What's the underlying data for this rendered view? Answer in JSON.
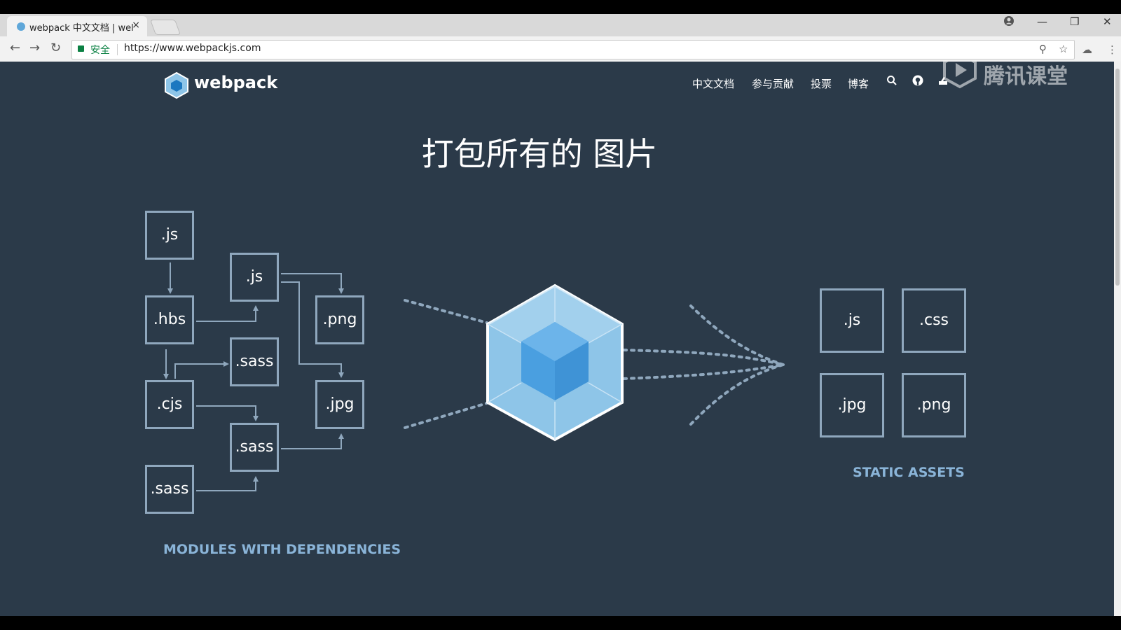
{
  "browser": {
    "tab_title": "webpack 中文文档 | wel",
    "tab_close": "×",
    "url": "https://www.webpackjs.com",
    "secure_label": "安全",
    "icons": [
      "back-icon",
      "forward-icon",
      "reload-icon",
      "lock-icon",
      "zoom-icon",
      "star-icon",
      "extension-icon",
      "menu-icon",
      "account-icon",
      "minimize-icon",
      "restore-icon",
      "close-icon"
    ]
  },
  "site": {
    "logo_text": "webpack",
    "nav": [
      "中文文档",
      "参与贡献",
      "投票",
      "博客"
    ],
    "nav_icons": [
      "search-icon",
      "github-icon",
      "language-icon"
    ]
  },
  "watermark": {
    "text": "腾讯课堂"
  },
  "hero": {
    "headline": "打包所有的 图片",
    "modules": [
      ".js",
      ".js",
      ".hbs",
      ".png",
      ".sass",
      ".cjs",
      ".jpg",
      ".sass",
      ".sass"
    ],
    "assets": [
      ".js",
      ".css",
      ".jpg",
      ".png"
    ],
    "modules_caption": "MODULES WITH DEPENDENCIES",
    "assets_caption": "STATIC ASSETS"
  },
  "colors": {
    "page_bg": "#2b3a49",
    "box_border": "#8fa7bd",
    "caption": "#8ab4d8",
    "cube_light": "#8ec5e8",
    "cube_dark": "#4a9fe0"
  }
}
